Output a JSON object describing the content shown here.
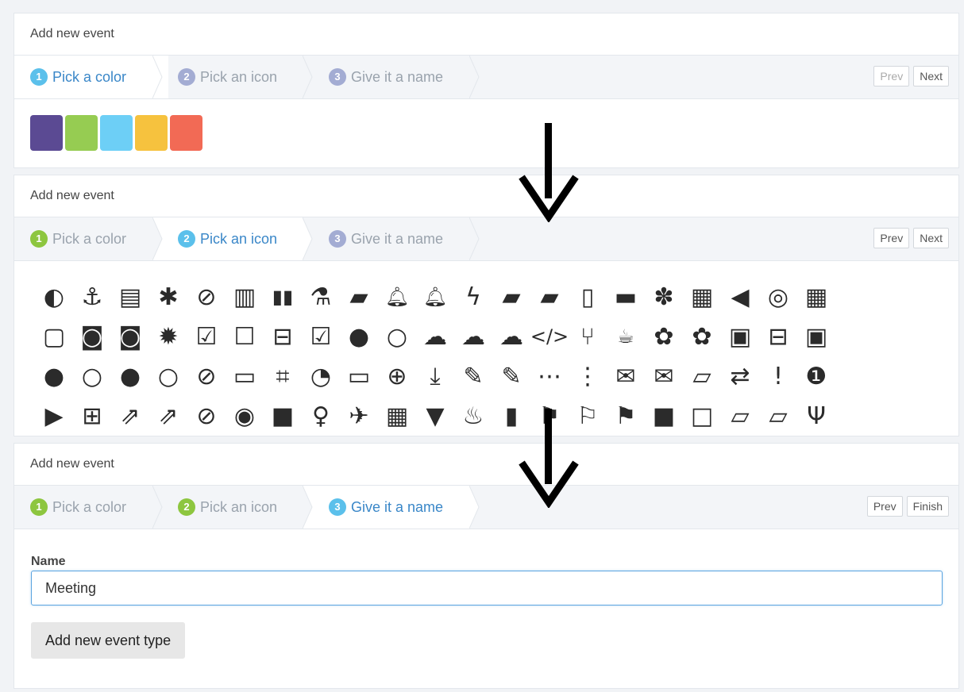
{
  "panels": [
    {
      "title": "Add new event",
      "steps": [
        {
          "num": "1",
          "label": "Pick a color"
        },
        {
          "num": "2",
          "label": "Pick an icon"
        },
        {
          "num": "3",
          "label": "Give it a name"
        }
      ],
      "prev": "Prev",
      "next": "Next"
    },
    {
      "title": "Add new event",
      "steps": [
        {
          "num": "1",
          "label": "Pick a color"
        },
        {
          "num": "2",
          "label": "Pick an icon"
        },
        {
          "num": "3",
          "label": "Give it a name"
        }
      ],
      "prev": "Prev",
      "next": "Next"
    },
    {
      "title": "Add new event",
      "steps": [
        {
          "num": "1",
          "label": "Pick a color"
        },
        {
          "num": "2",
          "label": "Pick an icon"
        },
        {
          "num": "3",
          "label": "Give it a name"
        }
      ],
      "prev": "Prev",
      "next": "Finish"
    }
  ],
  "colors": [
    "#5b4a93",
    "#96cc52",
    "#6dcff6",
    "#f6c23e",
    "#f26a55"
  ],
  "icons": [
    [
      "adjust-icon",
      "anchor-icon",
      "archive-icon",
      "asterisk-icon",
      "ban-icon",
      "bar-chart-icon",
      "barcode-icon",
      "flask-icon",
      "beer-icon",
      "bell-outline-icon",
      "bell-icon",
      "bolt-icon",
      "book-icon",
      "bookmark-icon",
      "bookmark-outline-icon",
      "briefcase-icon",
      "bug-icon",
      "building-icon",
      "bullhorn-icon",
      "bullseye-icon",
      "calendar-icon"
    ],
    [
      "calendar-outline-icon",
      "camera-icon",
      "camera-retro-icon",
      "certificate-icon",
      "check-square-icon",
      "square-outline-icon",
      "minus-square-outline-icon",
      "check-square-filled-icon",
      "circle-icon",
      "circle-outline-icon",
      "cloud-icon",
      "cloud-download-icon",
      "cloud-upload-icon",
      "code-icon",
      "code-fork-icon",
      "coffee-icon",
      "cog-icon",
      "cogs-icon",
      "caret-down-square-icon",
      "minus-square-icon",
      "caret-up-square-icon"
    ],
    [
      "comment-icon",
      "comment-outline-icon",
      "comments-icon",
      "comments-outline-icon",
      "compass-icon",
      "credit-card-icon",
      "crop-icon",
      "dashboard-icon",
      "desktop-icon",
      "download-circle-icon",
      "download-icon",
      "edit-icon",
      "pencil-square-icon",
      "ellipsis-h-icon",
      "ellipsis-v-icon",
      "envelope-icon",
      "envelope-outline-icon",
      "eraser-icon",
      "exchange-icon",
      "exclamation-icon",
      "exclamation-circle-icon"
    ],
    [
      "play-square-icon",
      "plus-square-icon",
      "external-link-icon",
      "external-link-square-icon",
      "eye-slash-icon",
      "eye-icon",
      "video-camera-icon",
      "female-icon",
      "plane-icon",
      "film-icon",
      "filter-icon",
      "fire-icon",
      "fire-extinguisher-icon",
      "flag-icon",
      "flag-outline-icon",
      "flag-checkered-icon",
      "folder-icon",
      "folder-outline-icon",
      "folder-open-icon",
      "folder-open-outline-icon",
      "cutlery-icon"
    ]
  ],
  "glyphs": [
    [
      "◐",
      "⚓",
      "▤",
      "✱",
      "⊘",
      "▥",
      "▮▮",
      "⚗",
      "▰",
      "🔔︎",
      "🔔︎",
      "ϟ",
      "▰",
      "▰",
      "▯",
      "▬",
      "✽",
      "▦",
      "◀",
      "◎",
      "▦"
    ],
    [
      "▢",
      "◙",
      "◙",
      "✹",
      "☑",
      "☐",
      "⊟",
      "☑",
      "●",
      "○",
      "☁",
      "☁",
      "☁",
      "</>",
      "⑂",
      "☕︎",
      "✿",
      "✿",
      "▣",
      "⊟",
      "▣"
    ],
    [
      "●",
      "○",
      "●",
      "○",
      "⊘",
      "▭",
      "⌗",
      "◔",
      "▭",
      "⊕",
      "⤓",
      "✎",
      "✎",
      "⋯",
      "⋮",
      "✉",
      "✉",
      "▱",
      "⇄",
      "!",
      "❶"
    ],
    [
      "▶",
      "⊞",
      "⇗",
      "⇗",
      "⊘",
      "◉",
      "■",
      "♀",
      "✈",
      "▦",
      "▼",
      "♨",
      "▮",
      "⚑",
      "⚐",
      "⚑",
      "■",
      "□",
      "▱",
      "▱",
      "Ψ"
    ]
  ],
  "name_field": {
    "label": "Name",
    "value": "Meeting"
  },
  "submit_label": "Add new event type"
}
